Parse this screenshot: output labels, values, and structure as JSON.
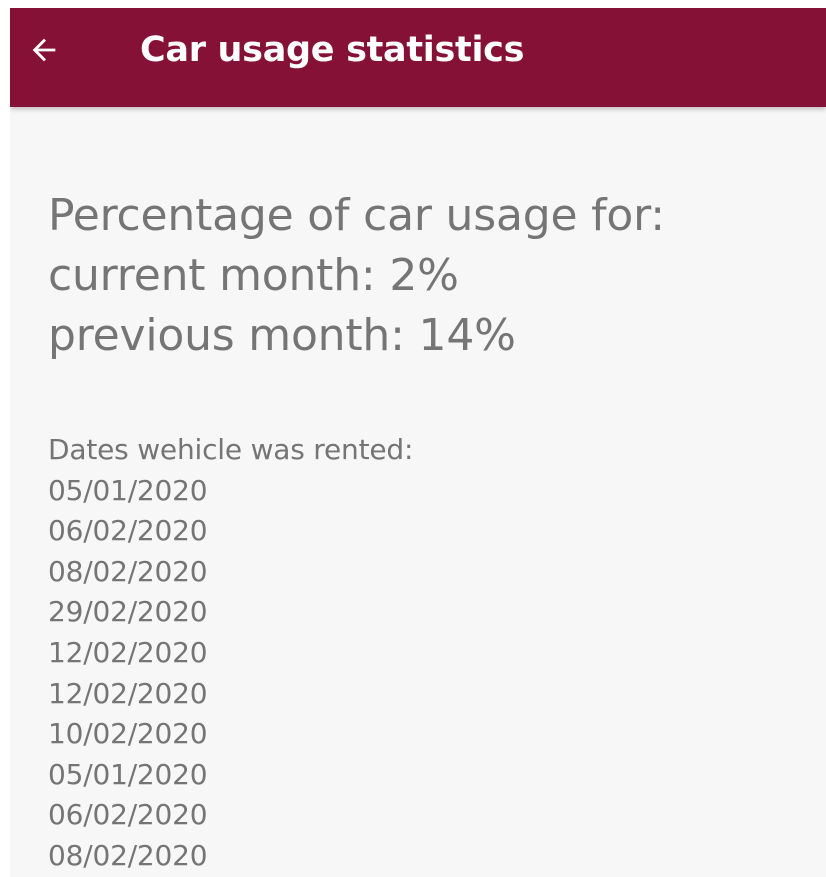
{
  "app_bar": {
    "title": "Car usage statistics",
    "back_icon": "arrow-left-icon",
    "background_color": "#851136",
    "text_color": "#ffffff"
  },
  "usage": {
    "heading": "Percentage of car usage for:",
    "current_month": "current month: 2%",
    "previous_month": "previous month: 14%"
  },
  "rentals": {
    "heading": "Dates wehicle was rented:",
    "dates": [
      "05/01/2020",
      "06/02/2020",
      "08/02/2020",
      "29/02/2020",
      "12/02/2020",
      "12/02/2020",
      "10/02/2020",
      "05/01/2020",
      "06/02/2020",
      "08/02/2020"
    ]
  }
}
